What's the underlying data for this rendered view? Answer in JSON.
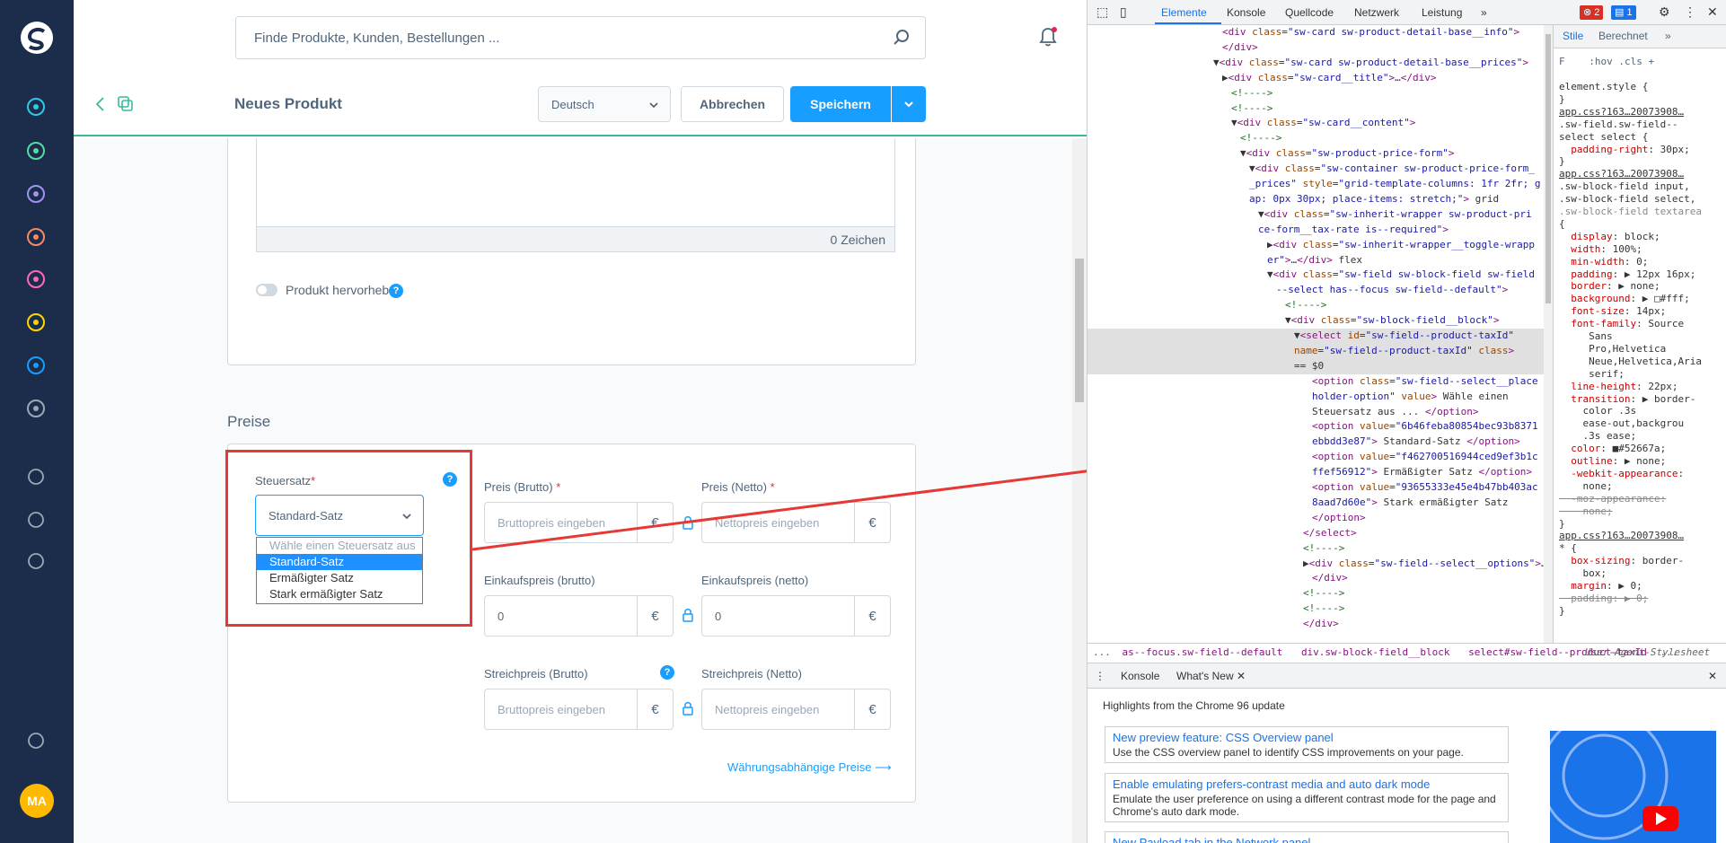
{
  "colors": {
    "sidebar_bg": "#1b2d4b",
    "accent": "#189eff",
    "nav_active": "#3cb99a",
    "annotation_red": "#e53935",
    "avatar_bg": "#ffb900"
  },
  "sidebar": {
    "items": [
      {
        "icon": "dashboard-icon",
        "color": "#30c7e8"
      },
      {
        "icon": "catalogue-icon",
        "color": "#57d9a3"
      },
      {
        "icon": "orders-icon",
        "color": "#a092f0"
      },
      {
        "icon": "customers-icon",
        "color": "#f88962"
      },
      {
        "icon": "content-icon",
        "color": "#ff68b4"
      },
      {
        "icon": "marketing-icon",
        "color": "#ffd700"
      },
      {
        "icon": "extensions-icon",
        "color": "#189eff"
      },
      {
        "icon": "settings-icon",
        "color": "#9aa8b5"
      }
    ],
    "bottom_items": [
      "add-channel-icon",
      "basket-icon",
      "storefront-icon",
      "help-icon"
    ],
    "avatar_initials": "MA"
  },
  "search": {
    "placeholder": "Finde Produkte, Kunden, Bestellungen ..."
  },
  "smart_bar": {
    "title": "Neues Produkt",
    "language": "Deutsch",
    "cancel_label": "Abbrechen",
    "save_label": "Speichern"
  },
  "description_card": {
    "char_count": "0 Zeichen",
    "highlight_label": "Produkt hervorheben",
    "help": "?"
  },
  "prices": {
    "section_title": "Preise",
    "tax_label": "Steuersatz",
    "required_mark": "*",
    "tax_selected": "Standard-Satz",
    "tax_options": [
      "Wähle einen Steuersatz aus ...",
      "Standard-Satz",
      "Ermäßigter Satz",
      "Stark ermäßigter Satz"
    ],
    "price_gross_label": "Preis (Brutto)",
    "price_net_label": "Preis (Netto)",
    "price_gross_placeholder": "Bruttopreis eingeben ...",
    "price_net_placeholder": "Nettopreis eingeben ...",
    "purchase_gross_label": "Einkaufspreis (brutto)",
    "purchase_net_label": "Einkaufspreis (netto)",
    "purchase_gross_value": "0",
    "purchase_net_value": "0",
    "list_gross_label": "Streichpreis (Brutto)",
    "list_net_label": "Streichpreis (Netto)",
    "list_gross_placeholder": "Bruttopreis eingeben ...",
    "list_net_placeholder": "Nettopreis eingeben ...",
    "currency": "€",
    "currency_link": "Währungsabhängige Preise"
  },
  "devtools": {
    "tabs": [
      "Elemente",
      "Konsole",
      "Quellcode",
      "Netzwerk",
      "Leistung"
    ],
    "more": "»",
    "errors": "2",
    "messages": "1",
    "dom_lines": [
      {
        "kind": "raw",
        "html": "<span class='tn'>&lt;div</span> <span class='an'>class</span>=<span class='av'>\"sw-card sw-product-detail-base__info\"</span><span class='tn'>&gt;</span>"
      },
      {
        "kind": "raw",
        "html": "<span class='tn'>&lt;/div&gt;</span>"
      },
      {
        "kind": "raw",
        "html": "▼<span class='tn'>&lt;div</span> <span class='an'>class</span>=<span class='av'>\"sw-card sw-product-detail-base__prices\"</span><span class='tn'>&gt;</span>"
      },
      {
        "kind": "raw",
        "html": "▶<span class='tn'>&lt;div</span> <span class='an'>class</span>=<span class='av'>\"sw-card__title\"</span><span class='tn'>&gt;</span>…<span class='tn'>&lt;/div&gt;</span>"
      },
      {
        "kind": "raw",
        "html": "<span class='cm'>&lt;!----&gt;</span>"
      },
      {
        "kind": "raw",
        "html": "<span class='cm'>&lt;!----&gt;</span>"
      },
      {
        "kind": "raw",
        "html": "▼<span class='tn'>&lt;div</span> <span class='an'>class</span>=<span class='av'>\"sw-card__content\"</span><span class='tn'>&gt;</span>"
      },
      {
        "kind": "raw",
        "html": "<span class='cm'>&lt;!----&gt;</span>"
      },
      {
        "kind": "raw",
        "html": "▼<span class='tn'>&lt;div</span> <span class='an'>class</span>=<span class='av'>\"sw-product-price-form\"</span><span class='tn'>&gt;</span>"
      },
      {
        "kind": "raw",
        "html": "▼<span class='tn'>&lt;div</span> <span class='an'>class</span>=<span class='av'>\"sw-container sw-product-price-form_</span>"
      },
      {
        "kind": "raw",
        "html": "<span class='av'>_prices\"</span> <span class='an'>style</span>=<span class='av'>\"grid-template-columns: 1fr 2fr; g</span>"
      },
      {
        "kind": "raw",
        "html": "<span class='av'>ap: 0px 30px; place-items: stretch;\"</span><span class='tn'>&gt;</span> grid"
      },
      {
        "kind": "raw",
        "html": "▼<span class='tn'>&lt;div</span> <span class='an'>class</span>=<span class='av'>\"sw-inherit-wrapper sw-product-pri</span>"
      },
      {
        "kind": "raw",
        "html": "<span class='av'>ce-form__tax-rate is--required\"</span><span class='tn'>&gt;</span>"
      },
      {
        "kind": "raw",
        "html": "▶<span class='tn'>&lt;div</span> <span class='an'>class</span>=<span class='av'>\"sw-inherit-wrapper__toggle-wrapp</span>"
      },
      {
        "kind": "raw",
        "html": "<span class='av'>er\"</span><span class='tn'>&gt;</span>…<span class='tn'>&lt;/div&gt;</span> flex"
      },
      {
        "kind": "raw",
        "html": "▼<span class='tn'>&lt;div</span> <span class='an'>class</span>=<span class='av'>\"sw-field sw-block-field sw-field</span>"
      },
      {
        "kind": "raw",
        "html": "<span class='av'>--select has--focus sw-field--default\"</span><span class='tn'>&gt;</span>"
      },
      {
        "kind": "raw",
        "html": "<span class='cm'>&lt;!----&gt;</span>"
      },
      {
        "kind": "raw",
        "html": "▼<span class='tn'>&lt;div</span> <span class='an'>class</span>=<span class='av'>\"sw-block-field__block\"</span><span class='tn'>&gt;</span>"
      },
      {
        "kind": "raw",
        "html": "▼<span class='tn'>&lt;select</span> <span class='an'>id</span>=<span class='av'>\"sw-field--product-taxId\"</span>"
      },
      {
        "kind": "raw",
        "html": "<span class='an'>name</span>=<span class='av'>\"sw-field--product-taxId\"</span> <span class='an'>class</span><span class='tn'>&gt;</span>"
      },
      {
        "kind": "raw",
        "html": "== $0"
      },
      {
        "kind": "raw",
        "html": "<span class='tn'>&lt;option</span> <span class='an'>class</span>=<span class='av'>\"sw-field--select__place</span>"
      },
      {
        "kind": "raw",
        "html": "<span class='av'>holder-option\"</span> <span class='an'>value</span><span class='tn'>&gt;</span> Wähle einen"
      },
      {
        "kind": "raw",
        "html": "Steuersatz aus ... <span class='tn'>&lt;/option&gt;</span>"
      },
      {
        "kind": "raw",
        "html": "<span class='tn'>&lt;option</span> <span class='an'>value</span>=<span class='av'>\"6b46feba80854bec93b8371</span>"
      },
      {
        "kind": "raw",
        "html": "<span class='av'>ebbdd3e87\"</span><span class='tn'>&gt;</span> Standard-Satz <span class='tn'>&lt;/option&gt;</span>"
      },
      {
        "kind": "raw",
        "html": "<span class='tn'>&lt;option</span> <span class='an'>value</span>=<span class='av'>\"f462700516944ced9ef3b1c</span>"
      },
      {
        "kind": "raw",
        "html": "<span class='av'>ffef56912\"</span><span class='tn'>&gt;</span> Ermäßigter Satz <span class='tn'>&lt;/option&gt;</span>"
      },
      {
        "kind": "raw",
        "html": "<span class='tn'>&lt;option</span> <span class='an'>value</span>=<span class='av'>\"93655333e45e4b47bb403ac</span>"
      },
      {
        "kind": "raw",
        "html": "<span class='av'>8aad7d60e\"</span><span class='tn'>&gt;</span> Stark ermäßigter Satz"
      },
      {
        "kind": "raw",
        "html": "<span class='tn'>&lt;/option&gt;</span>"
      },
      {
        "kind": "raw",
        "html": "<span class='tn'>&lt;/select&gt;</span>"
      },
      {
        "kind": "raw",
        "html": "<span class='cm'>&lt;!----&gt;</span>"
      },
      {
        "kind": "raw",
        "html": "▶<span class='tn'>&lt;div</span> <span class='an'>class</span>=<span class='av'>\"sw-field--select__options\"</span><span class='tn'>&gt;</span>…"
      },
      {
        "kind": "raw",
        "html": "<span class='tn'>&lt;/div&gt;</span>"
      },
      {
        "kind": "raw",
        "html": "<span class='cm'>&lt;!----&gt;</span>"
      },
      {
        "kind": "raw",
        "html": "<span class='cm'>&lt;!----&gt;</span>"
      },
      {
        "kind": "raw",
        "html": "<span class='tn'>&lt;/div&gt;</span>"
      }
    ],
    "styles_tabs": [
      "Stile",
      "Berechnet"
    ],
    "styles_filter": ":hov .cls",
    "styles_lines": [
      "<span>element.style {</span>",
      "<span>}</span>",
      "<span style='text-decoration:underline'>app.css?163…20073908…</span>",
      "<span>.sw-field.sw-field--</span>",
      "<span>select select {</span>",
      "<span>&nbsp;&nbsp;<span class='pn'>padding-right</span>: 30px;</span>",
      "<span>}</span>",
      "<span style='text-decoration:underline'>app.css?163…20073908…</span>",
      "<span>.sw-block-field input,</span>",
      "<span>.sw-block-field select,</span>",
      "<span style='color:#888'>.sw-block-field textarea</span>",
      "<span>{</span>",
      "<span>&nbsp;&nbsp;<span class='pn'>display</span>: block;</span>",
      "<span>&nbsp;&nbsp;<span class='pn'>width</span>: 100%;</span>",
      "<span>&nbsp;&nbsp;<span class='pn'>min-width</span>: 0;</span>",
      "<span>&nbsp;&nbsp;<span class='pn'>padding</span>: ▶ 12px 16px;</span>",
      "<span>&nbsp;&nbsp;<span class='pn'>border</span>: ▶ none;</span>",
      "<span>&nbsp;&nbsp;<span class='pn'>background</span>: ▶ □#fff;</span>",
      "<span>&nbsp;&nbsp;<span class='pn'>font-size</span>: 14px;</span>",
      "<span>&nbsp;&nbsp;<span class='pn'>font-family</span>: Source</span>",
      "<span>&nbsp;&nbsp;&nbsp;&nbsp;&nbsp;Sans</span>",
      "<span>&nbsp;&nbsp;&nbsp;&nbsp;&nbsp;Pro,Helvetica</span>",
      "<span>&nbsp;&nbsp;&nbsp;&nbsp;&nbsp;Neue,Helvetica,Aria</span>",
      "<span>&nbsp;&nbsp;&nbsp;&nbsp;&nbsp;serif;</span>",
      "<span>&nbsp;&nbsp;<span class='pn'>line-height</span>: 22px;</span>",
      "<span>&nbsp;&nbsp;<span class='pn'>transition</span>: ▶ border-</span>",
      "<span>&nbsp;&nbsp;&nbsp;&nbsp;color .3s</span>",
      "<span>&nbsp;&nbsp;&nbsp;&nbsp;ease-out,backgrou</span>",
      "<span>&nbsp;&nbsp;&nbsp;&nbsp;.3s ease;</span>",
      "<span>&nbsp;&nbsp;<span class='pn'>color</span>: ■#52667a;</span>",
      "<span>&nbsp;&nbsp;<span class='pn'>outline</span>: ▶ none;</span>",
      "<span>&nbsp;&nbsp;<span class='pn'>-webkit-appearance</span>:</span>",
      "<span>&nbsp;&nbsp;&nbsp;&nbsp;none;</span>",
      "<span style='text-decoration:line-through;color:#888'>&nbsp;&nbsp;-moz-appearance:</span>",
      "<span style='text-decoration:line-through;color:#888'>&nbsp;&nbsp;&nbsp;&nbsp;none;</span>",
      "<span>}</span>",
      "<span style='text-decoration:underline'>app.css?163…20073908…</span>",
      "<span>* {</span>",
      "<span>&nbsp;&nbsp;<span class='pn'>box-sizing</span>: border-</span>",
      "<span>&nbsp;&nbsp;&nbsp;&nbsp;box;</span>",
      "<span>&nbsp;&nbsp;<span class='pn'>margin</span>: ▶ 0;</span>",
      "<span style='text-decoration:line-through;color:#888'>&nbsp;&nbsp;padding: ▶ 0;</span>",
      "<span>}</span>"
    ],
    "breadcrumbs": [
      "...",
      "as--focus.sw-field--default",
      "div.sw-block-field__block",
      "select#sw-field--product-taxId",
      "..."
    ],
    "user_agent": "User-Agent-Stylesheet",
    "drawer_tabs": [
      "Konsole",
      "What's New"
    ],
    "drawer_heading": "Highlights from the Chrome 96 update",
    "whats_new": [
      {
        "title": "New preview feature: CSS Overview panel",
        "desc": "Use the CSS overview panel to identify CSS improvements on your page."
      },
      {
        "title": "Enable emulating prefers-contrast media and auto dark mode",
        "desc": "Emulate the user preference on using a different contrast mode for the page and Chrome's auto dark mode."
      },
      {
        "title": "New Payload tab in the Network panel",
        "desc": ""
      }
    ]
  }
}
